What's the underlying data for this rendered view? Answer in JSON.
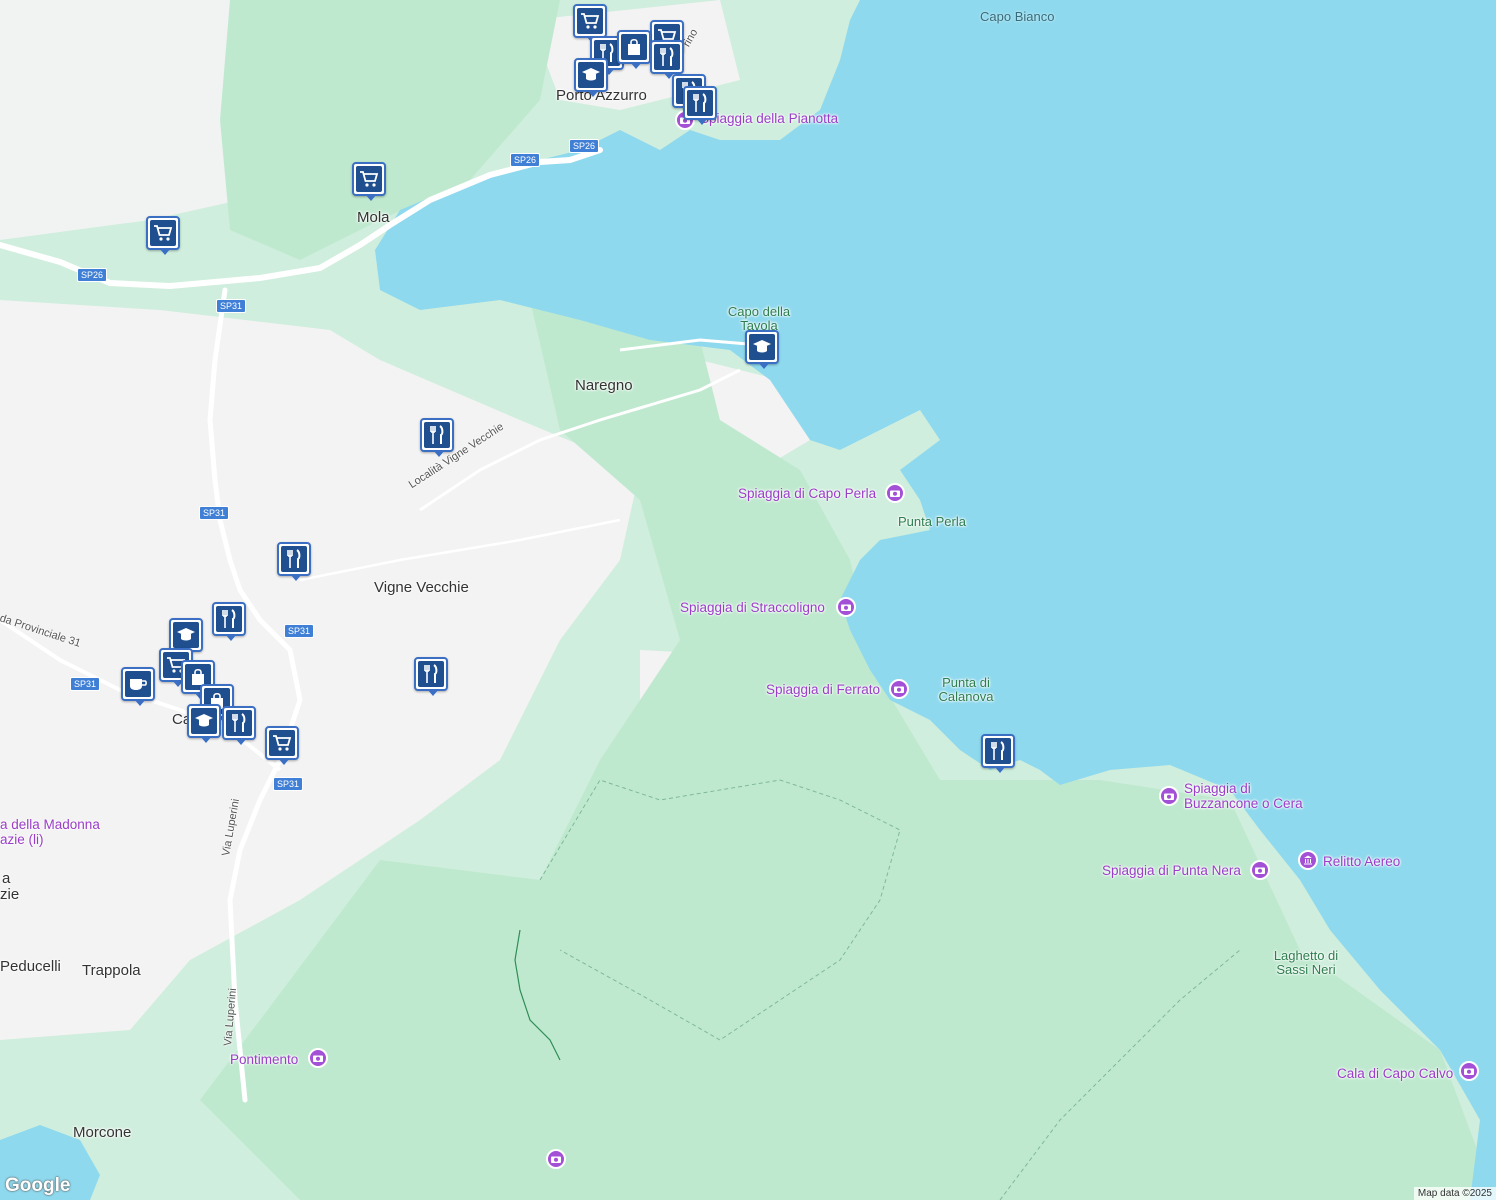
{
  "colors": {
    "water": "#8fd9ee",
    "land": "#f3f3f3",
    "park": "#cfeedd",
    "forest": "#bfe9cf",
    "road": "#ffffff",
    "pin_border": "#3a6fc4",
    "pin_fill": "#1f4f8f",
    "poi": "#9a3dc7"
  },
  "places": [
    {
      "name": "Porto Azzurro"
    },
    {
      "name": "Mola"
    },
    {
      "name": "Naregno"
    },
    {
      "name": "Vigne Vecchie"
    },
    {
      "name": "Trappola"
    },
    {
      "name": "Peducelli"
    },
    {
      "name": "Morcone"
    },
    {
      "name": "Ca"
    },
    {
      "name": "a"
    },
    {
      "name": "zie"
    }
  ],
  "nature_labels": [
    {
      "name": "Capo Bianco"
    },
    {
      "name": "Capo della Tavola"
    },
    {
      "name": "Punta Perla"
    },
    {
      "name": "Punta di Calanova"
    },
    {
      "name": "Laghetto di Sassi Neri"
    }
  ],
  "poi_labels": [
    {
      "name": "Spiaggia della Pianotta",
      "icon": "camera-icon"
    },
    {
      "name": "Spiaggia di Capo Perla",
      "icon": "camera-icon"
    },
    {
      "name": "Spiaggia di Straccoligno",
      "icon": "camera-icon"
    },
    {
      "name": "Spiaggia di Ferrato",
      "icon": "camera-icon"
    },
    {
      "name": "Spiaggia di Buzzancone o Cera",
      "icon": "camera-icon"
    },
    {
      "name": "Spiaggia di Punta Nera",
      "icon": "camera-icon"
    },
    {
      "name": "Relitto Aereo",
      "icon": "museum-icon"
    },
    {
      "name": "Cala di Capo Calvo",
      "icon": "camera-icon"
    },
    {
      "name": "Pontimento",
      "icon": "camera-icon"
    },
    {
      "name": "a della Madonna azie (li)",
      "icon": "church-icon"
    }
  ],
  "roads": [
    {
      "name": "SP26"
    },
    {
      "name": "SP26"
    },
    {
      "name": "SP26"
    },
    {
      "name": "SP31"
    },
    {
      "name": "SP31"
    },
    {
      "name": "SP31"
    },
    {
      "name": "SP31"
    },
    {
      "name": "SP31"
    }
  ],
  "road_names": [
    {
      "name": "Località Vigne Vecchie"
    },
    {
      "name": "da Provinciale 31"
    },
    {
      "name": "Via Luperini"
    },
    {
      "name": "Via Luperini"
    },
    {
      "name": "rino"
    }
  ],
  "pins": [
    {
      "icon": "shopping-cart-icon"
    },
    {
      "icon": "shopping-cart-icon"
    },
    {
      "icon": "restaurant-icon"
    },
    {
      "icon": "restaurant-icon"
    },
    {
      "icon": "school-icon"
    },
    {
      "icon": "restaurant-icon"
    },
    {
      "icon": "school-icon"
    },
    {
      "icon": "restaurant-icon"
    },
    {
      "icon": "coffee-icon"
    },
    {
      "icon": "restaurant-icon"
    },
    {
      "icon": "school-icon"
    },
    {
      "icon": "shopping-cart-icon"
    },
    {
      "icon": "restaurant-icon"
    },
    {
      "icon": "shopping-cart-icon"
    },
    {
      "icon": "shopping-bag-icon"
    },
    {
      "icon": "restaurant-icon"
    },
    {
      "icon": "school-icon"
    },
    {
      "icon": "restaurant-icon"
    },
    {
      "icon": "restaurant-icon"
    }
  ],
  "branding": {
    "logo": "Google",
    "attribution": "Map data ©2025"
  }
}
